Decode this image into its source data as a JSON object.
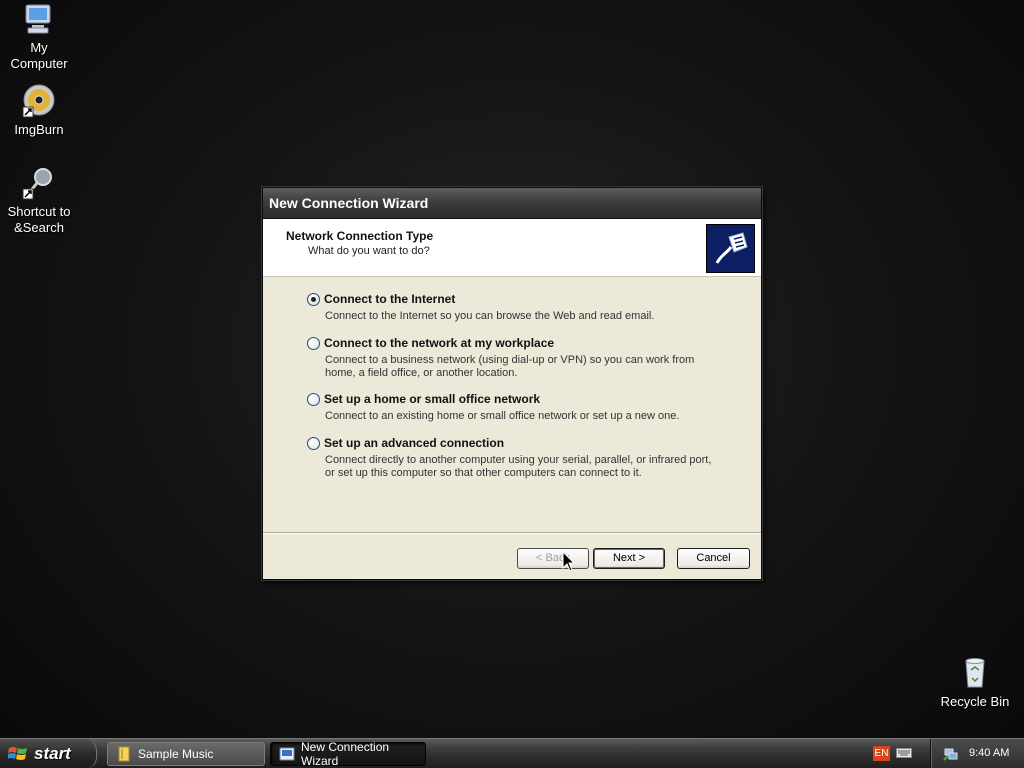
{
  "desktop": {
    "icons": [
      {
        "label": "My Computer",
        "icon": "my-computer-icon"
      },
      {
        "label": "ImgBurn",
        "icon": "imgburn-disc-icon"
      },
      {
        "label": "Shortcut to &Search",
        "icon": "search-shortcut-icon"
      },
      {
        "label": "Recycle Bin",
        "icon": "recycle-bin-icon"
      }
    ]
  },
  "wizard": {
    "title": "New Connection Wizard",
    "header_title": "Network Connection Type",
    "header_subtitle": "What do you want to do?",
    "options": [
      {
        "label": "Connect to the Internet",
        "desc": "Connect to the Internet so you can browse the Web and read email.",
        "selected": true
      },
      {
        "label": "Connect to the network at my workplace",
        "desc": "Connect to a business network (using dial-up or VPN) so you can work from home, a field office, or another location.",
        "selected": false
      },
      {
        "label": "Set up a home or small office network",
        "desc": "Connect to an existing home or small office network or set up a new one.",
        "selected": false
      },
      {
        "label": "Set up an advanced connection",
        "desc": "Connect directly to another computer using your serial, parallel, or infrared port, or set up this computer so that other computers can connect to it.",
        "selected": false
      }
    ],
    "buttons": {
      "back": "< Back",
      "next": "Next >",
      "cancel": "Cancel"
    }
  },
  "taskbar": {
    "start_label": "start",
    "tasks": [
      {
        "label": "Sample Music",
        "icon": "folder-icon",
        "active": false
      },
      {
        "label": "New Connection Wizard",
        "icon": "wizard-icon",
        "active": true
      }
    ],
    "language": "EN",
    "clock": "9:40 AM"
  },
  "colors": {
    "accent": "#0d1f63",
    "lang_badge": "#d9441a"
  }
}
